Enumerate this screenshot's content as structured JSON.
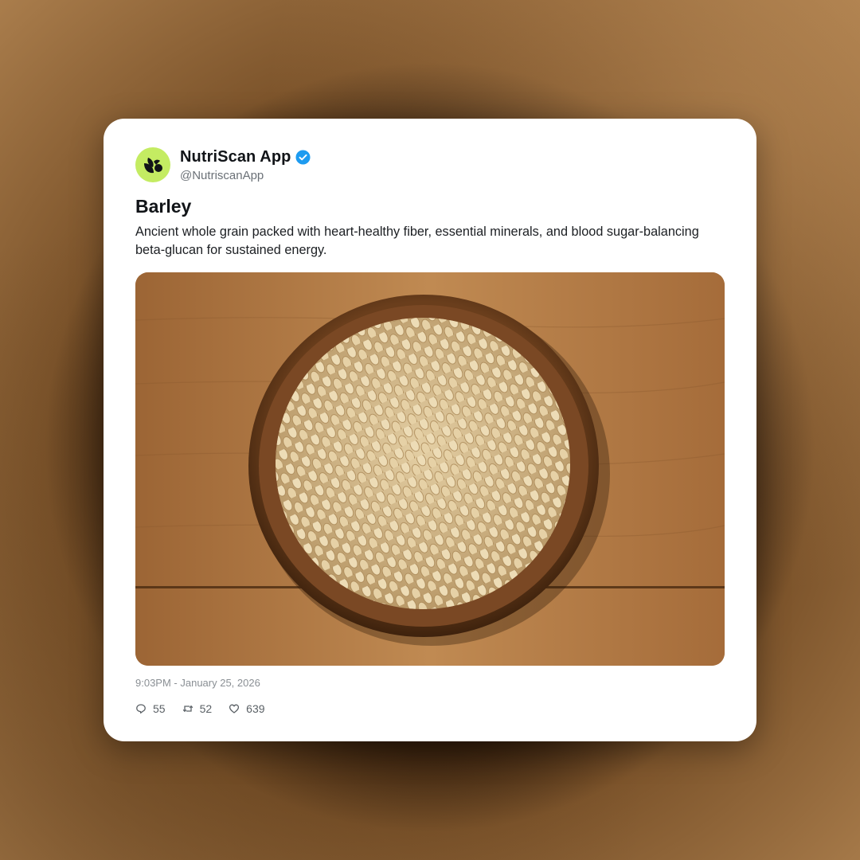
{
  "post": {
    "author": {
      "display_name": "NutriScan App",
      "handle": "@NutriscanApp",
      "verified": true,
      "avatar_icon": "leaf-seed-logo-icon",
      "avatar_color": "#c4ec62"
    },
    "title": "Barley",
    "body": "Ancient whole grain packed with heart-healthy fiber, essential minerals, and blood sugar-balancing beta-glucan for sustained energy.",
    "image": {
      "subject": "bowl of barley grains on wooden table"
    },
    "timestamp": "9:03PM - January 25, 2026",
    "stats": {
      "replies": "55",
      "reposts": "52",
      "likes": "639"
    }
  },
  "colors": {
    "verified_badge": "#1d9bf0",
    "card_background": "#ffffff",
    "backdrop": "#8a6034"
  }
}
